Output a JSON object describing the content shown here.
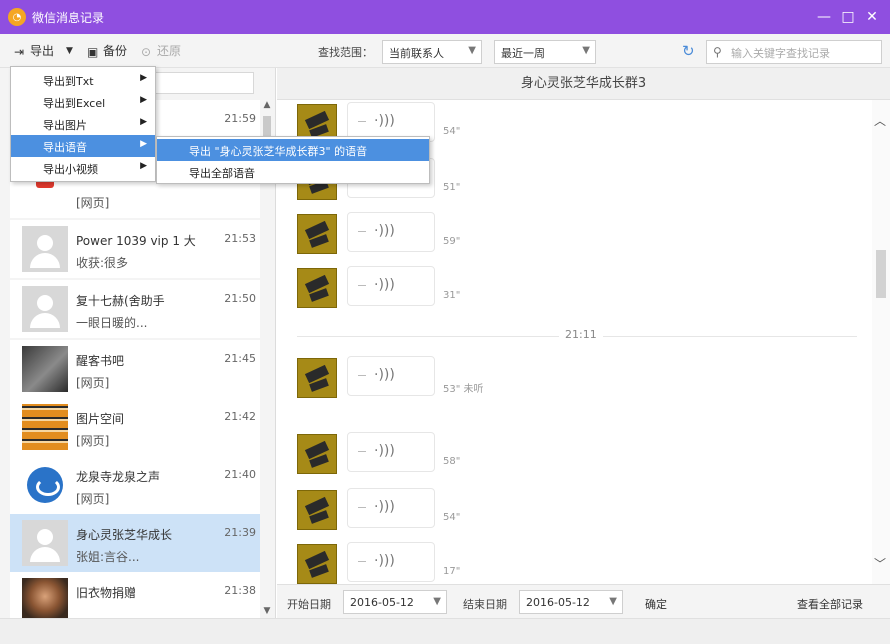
{
  "window": {
    "title": "微信消息记录",
    "logo": "wechat-logo-icon",
    "controls": [
      "—",
      "□",
      "✕"
    ]
  },
  "toolbar": {
    "export_label": "导出",
    "backup_label": "备份",
    "restore_label": "还原",
    "range_label": "查找范围：",
    "range_value": "当前联系人",
    "period_value": "最近一周",
    "search_placeholder": "输入关键字查找记录"
  },
  "export_menu": {
    "items": [
      {
        "label": "导出到Txt",
        "has_sub": true
      },
      {
        "label": "导出到Excel",
        "has_sub": true
      },
      {
        "label": "导出图片",
        "has_sub": true
      },
      {
        "label": "导出语音",
        "has_sub": true
      },
      {
        "label": "导出小视频",
        "has_sub": true
      }
    ],
    "submenu": [
      {
        "label": "导出 \"身心灵张芝华成长群3\" 的语音"
      },
      {
        "label": "导出全部语音"
      }
    ]
  },
  "contacts": [
    {
      "name": "",
      "time": "21:59",
      "msg": "",
      "avatar": "default"
    },
    {
      "name": "",
      "time": "",
      "msg": "[网页]",
      "avatar": "redlogo"
    },
    {
      "name": "Power 1039 vip 1 大",
      "time": "21:53",
      "msg": "收获:很多",
      "avatar": "default"
    },
    {
      "name": "复十七赫(舍助手",
      "time": "21:50",
      "msg": "一眼日暖的...",
      "avatar": "default"
    },
    {
      "name": "醒客书吧",
      "time": "21:45",
      "msg": "[网页]",
      "avatar": "portrait"
    },
    {
      "name": "图片空间",
      "time": "21:42",
      "msg": "[网页]",
      "avatar": "tribal"
    },
    {
      "name": "龙泉寺龙泉之声",
      "time": "21:40",
      "msg": "[网页]",
      "avatar": "logo-round"
    },
    {
      "name": "身心灵张芝华成长",
      "time": "21:39",
      "msg": "张姐:言谷...",
      "avatar": "default",
      "selected": true
    },
    {
      "name": "旧衣物捐赠",
      "time": "21:38",
      "msg": "",
      "avatar": "kid"
    }
  ],
  "conversation": {
    "title": "身心灵张芝华成长群3",
    "divider_time": "21:11",
    "voice_messages": [
      {
        "duration": "54\""
      },
      {
        "duration": "51\""
      },
      {
        "duration": "59\""
      },
      {
        "duration": "31\""
      },
      {
        "duration": "53\"  未听"
      },
      {
        "duration": "58\""
      },
      {
        "duration": "54\""
      },
      {
        "duration": "17\""
      }
    ]
  },
  "bottom": {
    "start_label": "开始日期",
    "start_date": "2016-05-12",
    "end_label": "结束日期",
    "end_date": "2016-05-12",
    "confirm_label": "确定",
    "view_all_label": "查看全部记录"
  }
}
